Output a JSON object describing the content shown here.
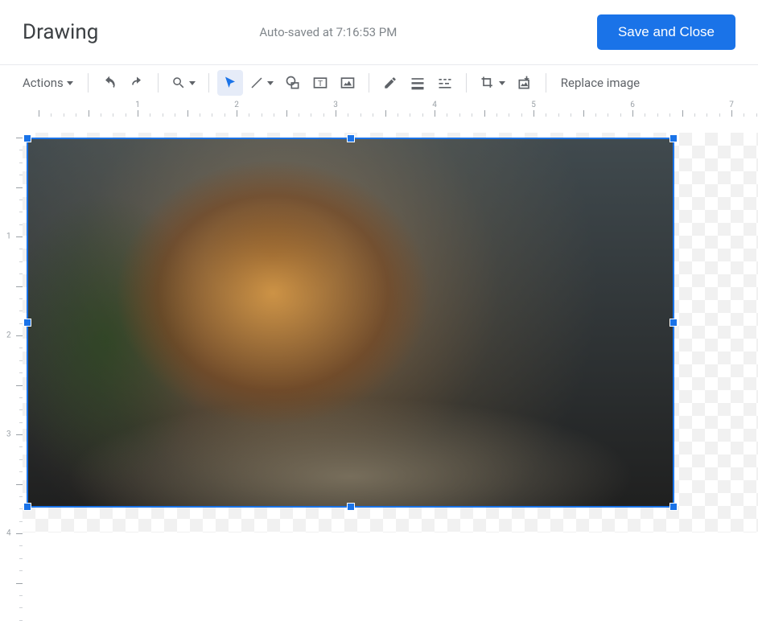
{
  "header": {
    "title": "Drawing",
    "autosave": "Auto-saved at 7:16:53 PM",
    "save_label": "Save and Close"
  },
  "toolbar": {
    "actions_label": "Actions",
    "replace_image_label": "Replace image",
    "icons": {
      "undo": "undo-icon",
      "redo": "redo-icon",
      "zoom": "zoom-icon",
      "select": "select-icon",
      "line": "line-icon",
      "shape": "shape-icon",
      "textbox": "textbox-icon",
      "image": "image-icon",
      "pen": "pen-icon",
      "border_weight": "border-weight-icon",
      "border_dash": "border-dash-icon",
      "crop": "crop-icon",
      "reset": "reset-image-icon"
    }
  },
  "ruler": {
    "h_labels": [
      "1",
      "2",
      "3",
      "4",
      "5",
      "6",
      "7"
    ],
    "v_labels": [
      "1",
      "2",
      "3",
      "4"
    ]
  },
  "canvas": {
    "selected_image_alt": "lion-photo",
    "selection_color": "#1a73e8"
  }
}
